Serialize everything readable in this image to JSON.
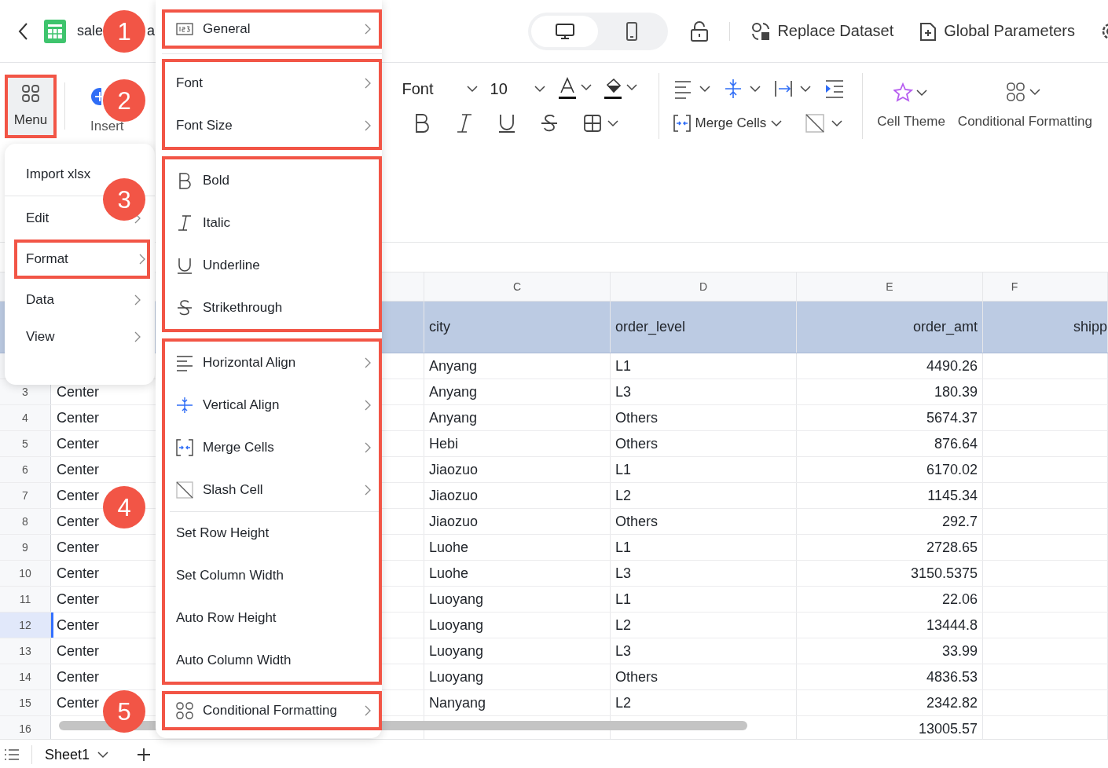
{
  "top_bar": {
    "title_parts": [
      "sale",
      "a"
    ],
    "view_modes": [
      {
        "kind": "desktop",
        "selected": true
      },
      {
        "kind": "phone",
        "selected": false
      }
    ],
    "actions": [
      {
        "kind": "dataset",
        "label": "Replace Dataset"
      },
      {
        "kind": "params",
        "label": "Global Parameters"
      }
    ]
  },
  "toolbar": {
    "menu_button": {
      "label": "Menu",
      "highlighted": true
    },
    "insert_button": {
      "label": "Insert"
    },
    "font": "Font",
    "font_size": "10",
    "merge_label": "Merge Cells",
    "cell_theme": "Cell Theme",
    "conditional_formatting": "Conditional Formatting"
  },
  "main_menu": {
    "items": [
      {
        "label": "Import xlsx",
        "submenu": false,
        "highlighted": false
      },
      {
        "label": "Edit",
        "submenu": true,
        "highlighted": false
      },
      {
        "label": "Format",
        "submenu": true,
        "highlighted": true
      },
      {
        "label": "Data",
        "submenu": true,
        "highlighted": false
      },
      {
        "label": "View",
        "submenu": true,
        "highlighted": false
      }
    ]
  },
  "format_menu": {
    "groups": [
      {
        "highlighted": true,
        "items": [
          {
            "kind": "number",
            "label": "General",
            "submenu": true
          }
        ]
      },
      {
        "highlighted": true,
        "items": [
          {
            "kind": "plain",
            "label": "Font",
            "submenu": true
          },
          {
            "kind": "plain",
            "label": "Font Size",
            "submenu": true
          }
        ]
      },
      {
        "highlighted": true,
        "items": [
          {
            "kind": "bold",
            "label": "Bold",
            "submenu": false
          },
          {
            "kind": "italic",
            "label": "Italic",
            "submenu": false
          },
          {
            "kind": "underline",
            "label": "Underline",
            "submenu": false
          },
          {
            "kind": "strike",
            "label": "Strikethrough",
            "submenu": false
          }
        ]
      },
      {
        "highlighted": true,
        "items": [
          {
            "kind": "halign",
            "label": "Horizontal Align",
            "submenu": true
          },
          {
            "kind": "valign",
            "label": "Vertical Align",
            "submenu": true
          },
          {
            "kind": "merge",
            "label": "Merge Cells",
            "submenu": true
          },
          {
            "kind": "slash",
            "label": "Slash Cell",
            "submenu": true
          },
          {
            "kind": "divider"
          },
          {
            "kind": "plain",
            "label": "Set Row Height",
            "submenu": false
          },
          {
            "kind": "plain",
            "label": "Set Column Width",
            "submenu": false
          },
          {
            "kind": "plain",
            "label": "Auto Row Height",
            "submenu": false
          },
          {
            "kind": "plain",
            "label": "Auto Column Width",
            "submenu": false
          }
        ]
      },
      {
        "highlighted": true,
        "items": [
          {
            "kind": "grid",
            "label": "Conditional Formatting",
            "submenu": true
          }
        ]
      }
    ]
  },
  "annotations": [
    {
      "number": "1"
    },
    {
      "number": "2"
    },
    {
      "number": "3"
    },
    {
      "number": "4"
    },
    {
      "number": "5"
    }
  ],
  "sheet": {
    "columns": [
      "C",
      "D",
      "E",
      "F"
    ],
    "header_row": {
      "cells": [
        "city",
        "order_level",
        "order_amt",
        "shipp"
      ]
    },
    "rows": [
      {
        "city": "Anyang",
        "order_level": "L1",
        "order_amt": "4490.26",
        "selected": false
      },
      {
        "number": "3",
        "column_b": "Center",
        "city": "Anyang",
        "order_level": "L3",
        "order_amt": "180.39",
        "selected": false
      },
      {
        "number": "4",
        "column_b": "Center",
        "city": "Anyang",
        "order_level": "Others",
        "order_amt": "5674.37",
        "selected": false
      },
      {
        "number": "5",
        "column_b": "Center",
        "city": "Hebi",
        "order_level": "Others",
        "order_amt": "876.64",
        "selected": false
      },
      {
        "number": "6",
        "column_b": "Center",
        "city": "Jiaozuo",
        "order_level": "L1",
        "order_amt": "6170.02",
        "selected": false
      },
      {
        "number": "7",
        "column_b": "Center",
        "city": "Jiaozuo",
        "order_level": "L2",
        "order_amt": "1145.34",
        "selected": false
      },
      {
        "number": "8",
        "column_b": "Center",
        "city": "Jiaozuo",
        "order_level": "Others",
        "order_amt": "292.7",
        "selected": false
      },
      {
        "number": "9",
        "column_b": "Center",
        "city": "Luohe",
        "order_level": "L1",
        "order_amt": "2728.65",
        "selected": false
      },
      {
        "number": "10",
        "column_b": "Center",
        "city": "Luohe",
        "order_level": "L3",
        "order_amt": "3150.5375",
        "selected": false
      },
      {
        "number": "11",
        "column_b": "Center",
        "city": "Luoyang",
        "order_level": "L1",
        "order_amt": "22.06",
        "selected": false
      },
      {
        "number": "12",
        "column_b": "Center",
        "city": "Luoyang",
        "order_level": "L2",
        "order_amt": "13444.8",
        "selected": true
      },
      {
        "number": "13",
        "column_b": "Center",
        "city": "Luoyang",
        "order_level": "L3",
        "order_amt": "33.99",
        "selected": false
      },
      {
        "number": "14",
        "column_b": "Center",
        "city": "Luoyang",
        "order_level": "Others",
        "order_amt": "4836.53",
        "selected": false
      },
      {
        "number": "15",
        "column_b": "Center",
        "city": "Nanyang",
        "order_level": "L2",
        "order_amt": "2342.82",
        "selected": false
      },
      {
        "number": "16",
        "order_amt": "13005.57",
        "selected": false
      }
    ]
  },
  "sheet_tabs": [
    {
      "label": "Sheet1",
      "selected": true
    }
  ]
}
